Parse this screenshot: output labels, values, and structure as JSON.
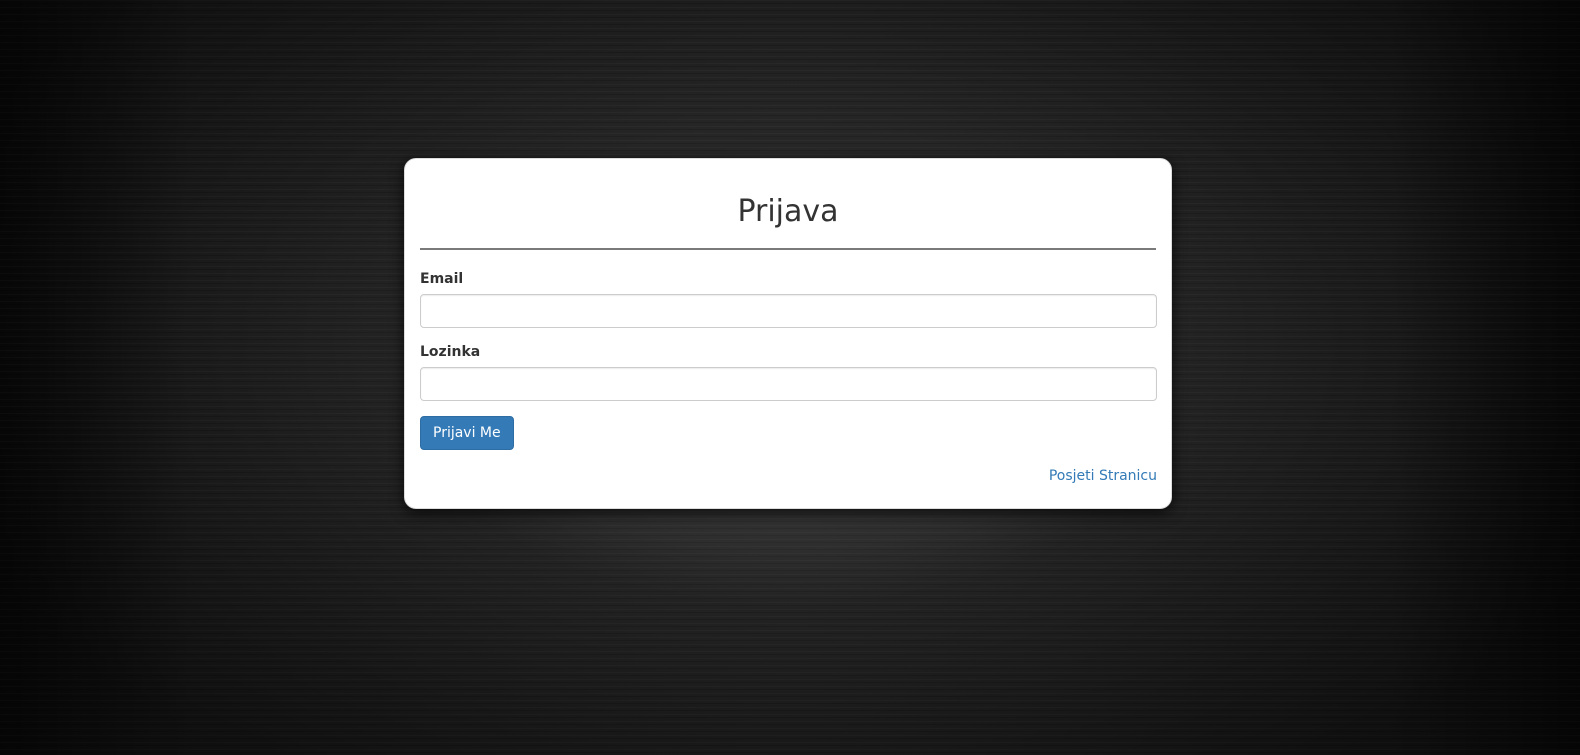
{
  "login": {
    "title": "Prijava",
    "email_label": "Email",
    "email_value": "",
    "password_label": "Lozinka",
    "password_value": "",
    "submit_label": "Prijavi Me",
    "visit_link_label": "Posjeti Stranicu"
  },
  "colors": {
    "primary": "#337ab7",
    "link": "#337ab7",
    "card_background": "#ffffff",
    "page_background": "#1a1a1a"
  }
}
